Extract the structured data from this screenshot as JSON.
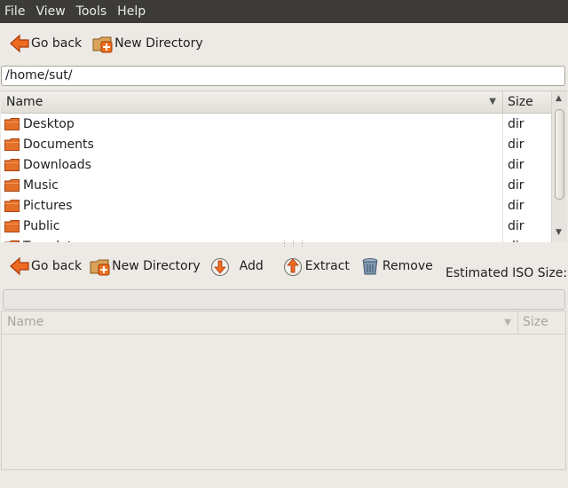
{
  "menu": [
    "File",
    "View",
    "Tools",
    "Help"
  ],
  "top_toolbar": {
    "go_back": "Go back",
    "new_directory": "New Directory"
  },
  "path": "/home/sut/",
  "file_list": {
    "columns": {
      "name": "Name",
      "size": "Size"
    },
    "rows": [
      {
        "name": "Desktop",
        "size": "dir"
      },
      {
        "name": "Documents",
        "size": "dir"
      },
      {
        "name": "Downloads",
        "size": "dir"
      },
      {
        "name": "Music",
        "size": "dir"
      },
      {
        "name": "Pictures",
        "size": "dir"
      },
      {
        "name": "Public",
        "size": "dir"
      },
      {
        "name": "Templates",
        "size": "dir"
      }
    ]
  },
  "iso_toolbar": {
    "go_back": "Go back",
    "new_directory": "New Directory",
    "add": "Add",
    "extract": "Extract",
    "remove": "Remove",
    "estimated_size_label": "Estimated ISO Size:"
  },
  "iso_path": "",
  "iso_list": {
    "columns": {
      "name": "Name",
      "size": "Size"
    }
  },
  "icons": {
    "go_back": "go-back-arrow-icon",
    "new_directory": "folder-new-icon",
    "add": "add-down-arrow-icon",
    "extract": "extract-up-arrow-icon",
    "remove": "trash-icon",
    "folder": "folder-icon"
  },
  "colors": {
    "menubar": "#3c3b37",
    "window": "#edeae5",
    "accent_orange": "#e8561a",
    "folder": "#e46f28"
  }
}
